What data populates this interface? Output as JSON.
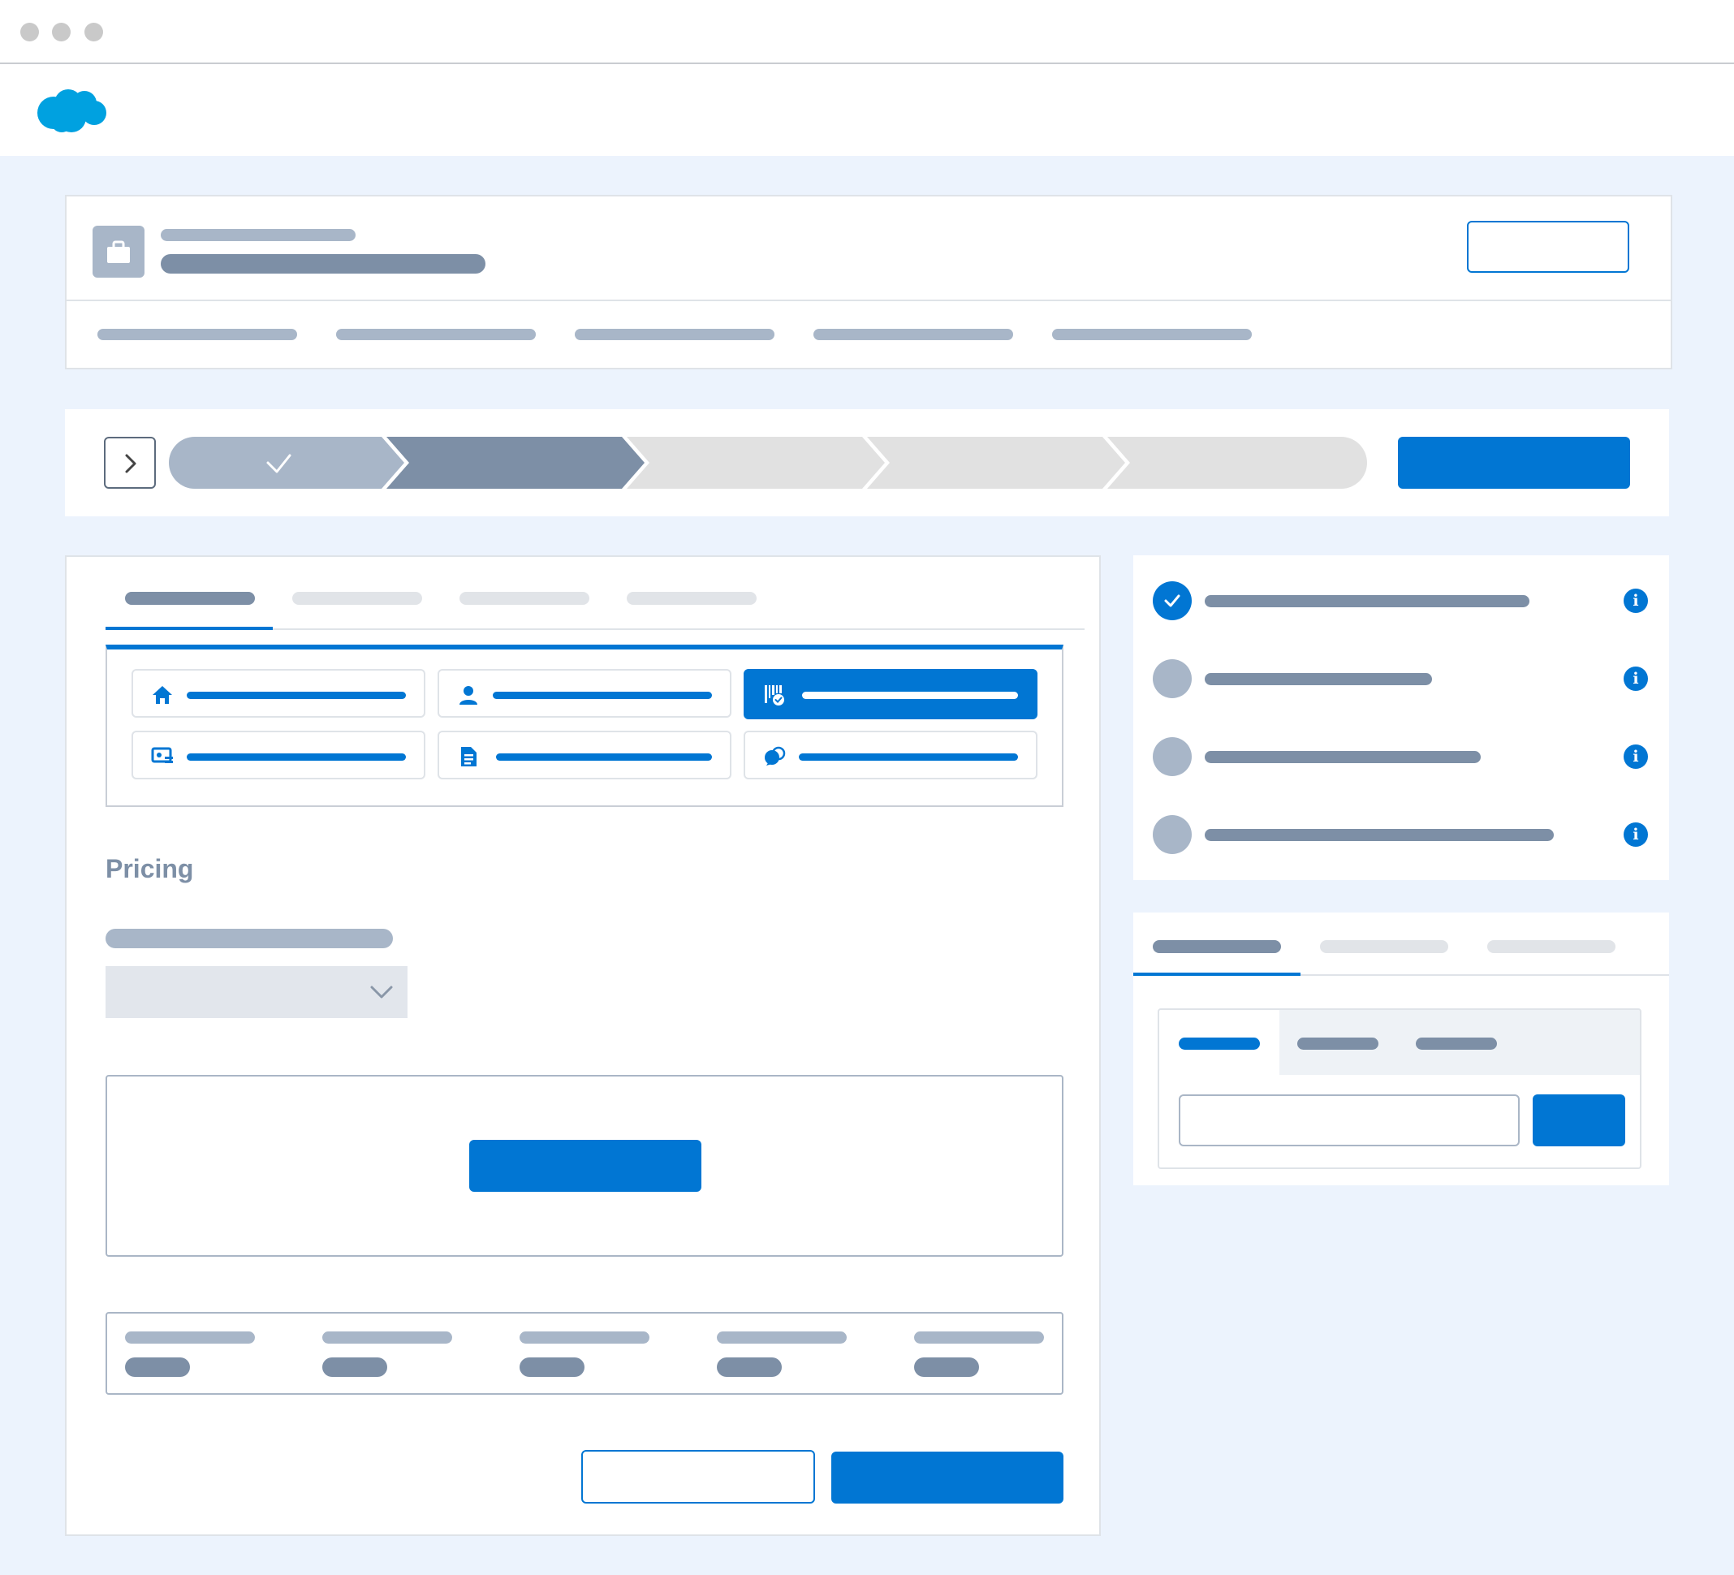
{
  "window": {
    "controls": [
      "close-dot",
      "minimize-dot",
      "maximize-dot"
    ]
  },
  "app": {
    "logo_icon": "cloud-logo-icon",
    "brand_color": "#0176d3"
  },
  "record_header": {
    "icon": "briefcase-icon"
  },
  "path": {
    "toggle_icon": "chevron-right-icon",
    "completed_icon": "check-icon",
    "stages": [
      "complete",
      "current",
      "incomplete",
      "incomplete",
      "incomplete"
    ]
  },
  "main": {
    "tiles": [
      {
        "icon": "home-icon",
        "active": false
      },
      {
        "icon": "user-icon",
        "active": false
      },
      {
        "icon": "barcode-check-icon",
        "active": true
      },
      {
        "icon": "id-card-icon",
        "active": false
      },
      {
        "icon": "document-icon",
        "active": false
      },
      {
        "icon": "chat-icon",
        "active": false
      }
    ],
    "section_title": "Pricing",
    "dropdown_icon": "chevron-down-icon"
  },
  "checklist": {
    "check_icon": "check-icon",
    "info_glyph": "i",
    "items": [
      "complete",
      "incomplete",
      "incomplete",
      "incomplete"
    ]
  },
  "colors": {
    "canvas": "#ecf3fd",
    "placeholder_dark": "#7d8fa6",
    "placeholder_mid": "#a8b6c8",
    "placeholder_light": "#e1e4e8"
  }
}
